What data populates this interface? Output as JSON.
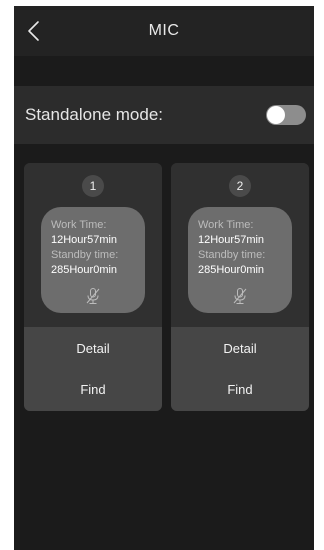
{
  "header": {
    "title": "MIC",
    "back_icon": "chevron-left-icon"
  },
  "standalone": {
    "label": "Standalone mode:",
    "enabled": false
  },
  "cards": [
    {
      "number": "1",
      "work_time_label": "Work Time:",
      "work_time_value": "12Hour57min",
      "standby_label": "Standby time:",
      "standby_value": "285Hour0min",
      "status_icon": "mic-off-icon",
      "detail_label": "Detail",
      "find_label": "Find"
    },
    {
      "number": "2",
      "work_time_label": "Work Time:",
      "work_time_value": "12Hour57min",
      "standby_label": "Standby time:",
      "standby_value": "285Hour0min",
      "status_icon": "mic-off-icon",
      "detail_label": "Detail",
      "find_label": "Find"
    }
  ],
  "colors": {
    "background": "#1b1b1b",
    "header": "#232323",
    "row": "#2c2c2c",
    "card": "#303030",
    "card_actions": "#464646",
    "info_box": "#6d6d6d",
    "toggle_off": "#8d8d8d"
  }
}
